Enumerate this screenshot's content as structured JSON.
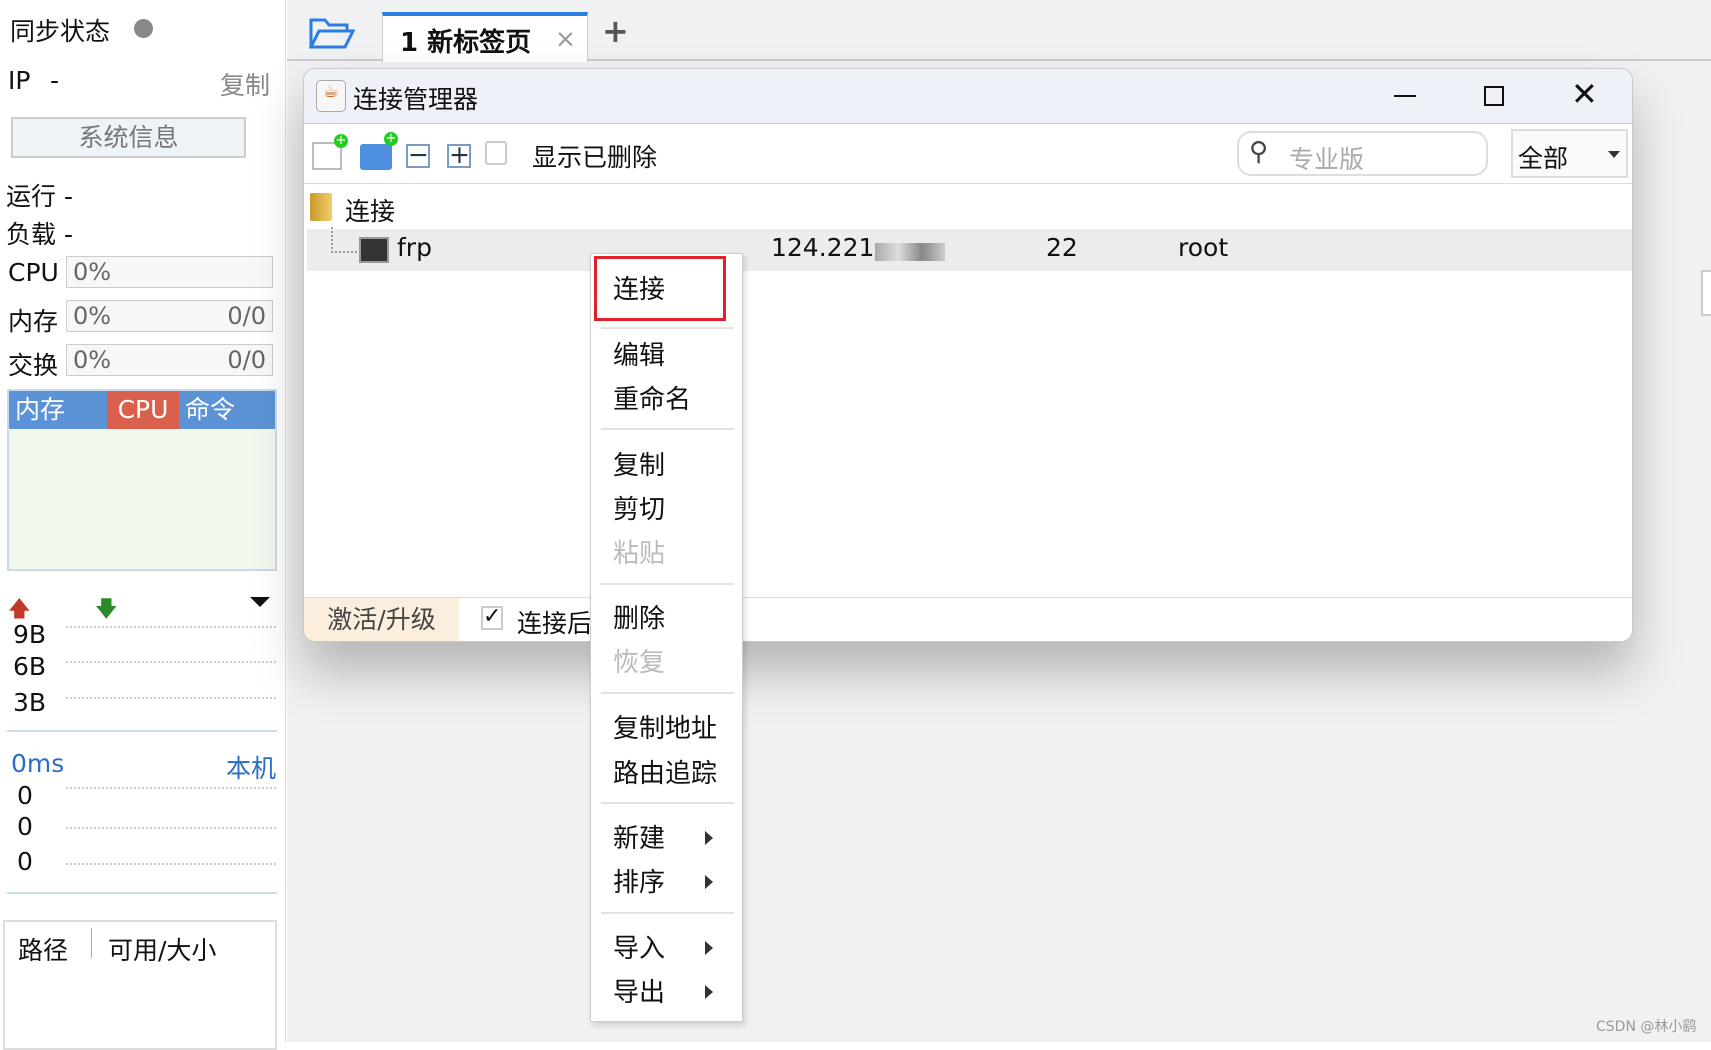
{
  "left": {
    "sync_label": "同步状态",
    "ip_label": "IP",
    "ip_value": "-",
    "copy_label": "复制",
    "sysinfo_button": "系统信息",
    "run_label": "运行 -",
    "load_label": "负载 -",
    "cpu_label": "CPU",
    "cpu_value": "0%",
    "mem_label": "内存",
    "mem_value": "0%",
    "mem_total": "0/0",
    "swap_label": "交换",
    "swap_value": "0%",
    "swap_total": "0/0",
    "tabs": [
      "内存",
      "CPU",
      "命令"
    ],
    "net_ticks": [
      "9B",
      "6B",
      "3B"
    ],
    "ping_label": "0ms",
    "ping_host": "本机",
    "ping_ticks": [
      "0",
      "0",
      "0"
    ],
    "disk_cols": [
      "路径",
      "可用/大小"
    ]
  },
  "tabbar": {
    "tab_label": "1 新标签页"
  },
  "window": {
    "title": "连接管理器",
    "show_deleted": "显示已删除",
    "search_placeholder": "专业版",
    "filter_value": "全部",
    "tree": {
      "group": "连接",
      "rows": [
        {
          "name": "frp",
          "host": "124.221.",
          "port": "22",
          "user": "root"
        }
      ]
    },
    "footer": {
      "activate": "激活/升级",
      "auto_label": "连接后"
    }
  },
  "menu": {
    "items": [
      "连接",
      "编辑",
      "重命名",
      "复制",
      "剪切",
      "粘贴",
      "删除",
      "恢复",
      "复制地址",
      "路由追踪",
      "新建",
      "排序",
      "导入",
      "导出"
    ]
  },
  "watermark": "CSDN @林小鹞",
  "colors": {
    "accent": "#2b7de1",
    "cpu_tab": "#d9604c",
    "mem_tab": "#5b93d6",
    "highlight": "#e0202a"
  }
}
